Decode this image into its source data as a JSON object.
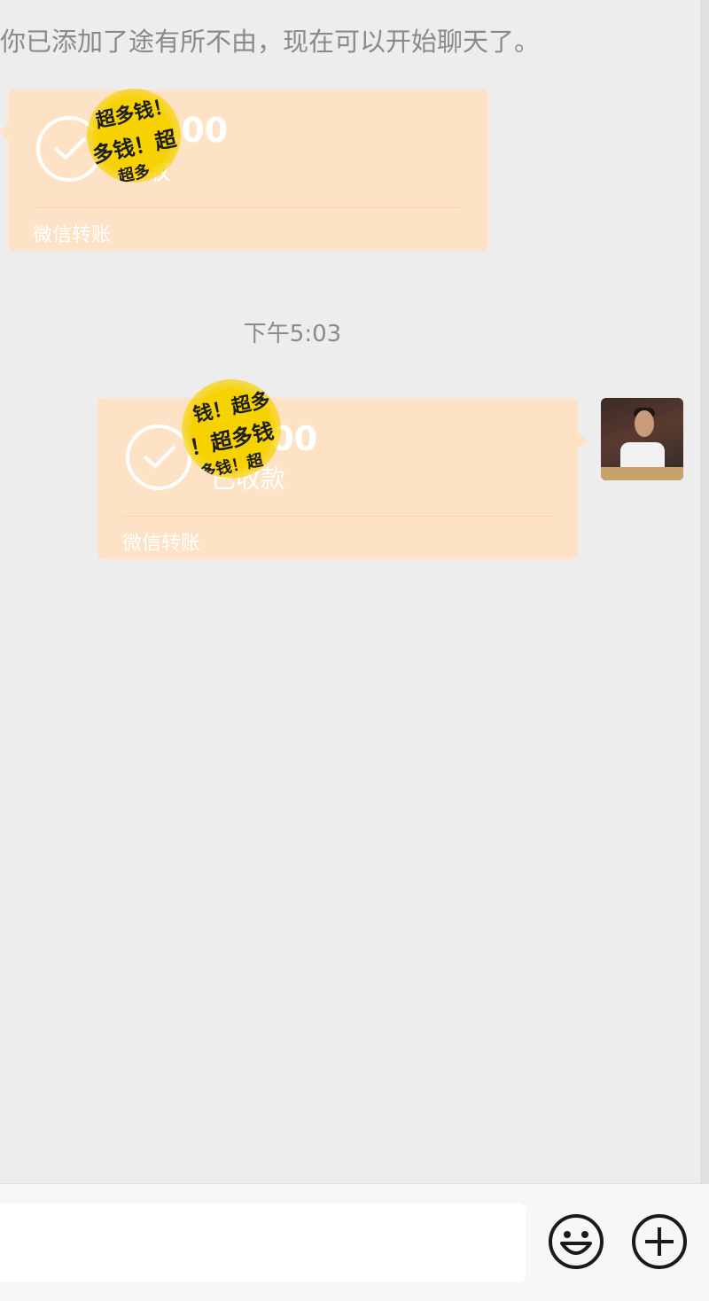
{
  "system_message": "你已添加了途有所不由，现在可以开始聊天了。",
  "timestamp": "下午5:03",
  "transfers": [
    {
      "amount": "00.00",
      "status": "接收",
      "label": "微信转账",
      "sticker": [
        "超多钱！",
        "多钱！超",
        "超多"
      ]
    },
    {
      "amount": "00.00",
      "status": "已收款",
      "label": "微信转账",
      "sticker": [
        "钱！超多",
        "！超多钱",
        "多钱！超"
      ]
    }
  ],
  "colors": {
    "background": "#ededed",
    "bubble": "#fde2c6",
    "sticker": "#f6d200"
  },
  "icons": [
    "check-icon",
    "emoji-icon",
    "plus-icon"
  ]
}
